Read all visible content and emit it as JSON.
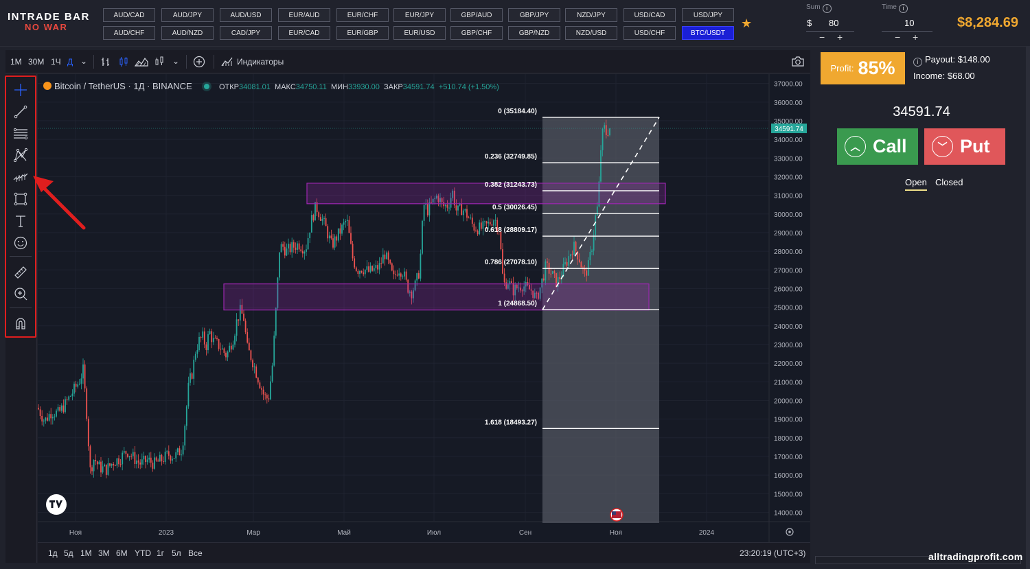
{
  "logo": {
    "line1": "INTRADE BAR",
    "line2": "NO WAR"
  },
  "pairs": {
    "row1": [
      "AUD/CAD",
      "AUD/JPY",
      "AUD/USD",
      "EUR/AUD",
      "EUR/CHF",
      "EUR/JPY",
      "GBP/AUD",
      "GBP/JPY",
      "NZD/JPY",
      "USD/CAD",
      "USD/JPY"
    ],
    "row2": [
      "AUD/CHF",
      "AUD/NZD",
      "CAD/JPY",
      "EUR/CAD",
      "EUR/GBP",
      "EUR/USD",
      "GBP/CHF",
      "GBP/NZD",
      "NZD/USD",
      "USD/CHF",
      "BTC/USDT"
    ],
    "active": "BTC/USDT"
  },
  "sum": {
    "label": "Sum",
    "currency": "$",
    "value": "80",
    "minus": "−",
    "plus": "+"
  },
  "time": {
    "label": "Time",
    "value": "10",
    "minus": "−",
    "plus": "+"
  },
  "balance": "$8,284.69",
  "toolbar": {
    "intervals": [
      "1М",
      "30М",
      "1Ч",
      "Д"
    ],
    "active_interval": "Д",
    "indicators_label": "Индикаторы",
    "icons": [
      "bar-chart-icon",
      "candle-chart-icon",
      "area-chart-icon",
      "chart-type-icon",
      "add-icon",
      "camera-icon"
    ]
  },
  "drawing_tools": [
    "crosshair-icon",
    "trend-line-icon",
    "fib-levels-icon",
    "pattern-icon",
    "forecast-icon",
    "rectangle-icon",
    "text-icon",
    "emoji-icon",
    "ruler-icon",
    "zoom-icon",
    "magnet-icon"
  ],
  "legend": {
    "symbol": "Bitcoin / TetherUS · 1Д · BINANCE",
    "open_label": "ОТКР",
    "open": "34081.01",
    "high_label": "МАКС",
    "high": "34750.11",
    "low_label": "МИН",
    "low": "33930.00",
    "close_label": "ЗАКР",
    "close": "34591.74",
    "change": "+510.74 (+1.50%)"
  },
  "chart_data": {
    "type": "candlestick",
    "y_ticks": [
      "37000.00",
      "36000.00",
      "35000.00",
      "34000.00",
      "33000.00",
      "32000.00",
      "31000.00",
      "30000.00",
      "29000.00",
      "28000.00",
      "27000.00",
      "26000.00",
      "25000.00",
      "24000.00",
      "23000.00",
      "22000.00",
      "21000.00",
      "20000.00",
      "19000.00",
      "18000.00",
      "17000.00",
      "16000.00",
      "15000.00",
      "14000.00"
    ],
    "ylim": [
      13500,
      37500
    ],
    "x_ticks": [
      "Ноя",
      "2023",
      "Мар",
      "Май",
      "Июл",
      "Сен",
      "Ноя",
      "2024"
    ],
    "last_price_label": "34591.74",
    "fib_levels": [
      {
        "label": "0 (35184.40)",
        "price": 35184.4
      },
      {
        "label": "0.236 (32749.85)",
        "price": 32749.85
      },
      {
        "label": "0.382 (31243.73)",
        "price": 31243.73
      },
      {
        "label": "0.5 (30026.45)",
        "price": 30026.45
      },
      {
        "label": "0.618 (28809.17)",
        "price": 28809.17
      },
      {
        "label": "0.786 (27078.10)",
        "price": 27078.1
      },
      {
        "label": "1 (24868.50)",
        "price": 24868.5
      },
      {
        "label": "1.618 (18493.27)",
        "price": 18493.27
      }
    ],
    "zones": [
      {
        "price_top": 31650,
        "price_bottom": 30550
      },
      {
        "price_top": 26250,
        "price_bottom": 24850
      }
    ],
    "price_path": [
      [
        0,
        19600
      ],
      [
        10,
        18900
      ],
      [
        20,
        19400
      ],
      [
        30,
        19300
      ],
      [
        40,
        19800
      ],
      [
        50,
        20400
      ],
      [
        60,
        21000
      ],
      [
        66,
        21600
      ],
      [
        72,
        19000
      ],
      [
        76,
        16200
      ],
      [
        82,
        16900
      ],
      [
        90,
        16400
      ],
      [
        100,
        16300
      ],
      [
        110,
        16700
      ],
      [
        120,
        16900
      ],
      [
        130,
        17300
      ],
      [
        140,
        16900
      ],
      [
        150,
        16600
      ],
      [
        160,
        16800
      ],
      [
        170,
        16600
      ],
      [
        180,
        16800
      ],
      [
        190,
        17100
      ],
      [
        200,
        17000
      ],
      [
        210,
        17400
      ],
      [
        215,
        19000
      ],
      [
        220,
        20900
      ],
      [
        225,
        21500
      ],
      [
        230,
        22700
      ],
      [
        235,
        23200
      ],
      [
        240,
        23400
      ],
      [
        245,
        22900
      ],
      [
        250,
        23700
      ],
      [
        255,
        23200
      ],
      [
        265,
        22900
      ],
      [
        275,
        22400
      ],
      [
        285,
        23400
      ],
      [
        290,
        24300
      ],
      [
        295,
        24800
      ],
      [
        300,
        24400
      ],
      [
        305,
        22800
      ],
      [
        312,
        22200
      ],
      [
        320,
        21300
      ],
      [
        330,
        20200
      ],
      [
        336,
        20100
      ],
      [
        342,
        22000
      ],
      [
        348,
        25500
      ],
      [
        352,
        28100
      ],
      [
        356,
        28300
      ],
      [
        362,
        28000
      ],
      [
        370,
        28200
      ],
      [
        380,
        28400
      ],
      [
        390,
        28100
      ],
      [
        398,
        29600
      ],
      [
        405,
        30400
      ],
      [
        412,
        29900
      ],
      [
        420,
        29200
      ],
      [
        428,
        28300
      ],
      [
        436,
        28800
      ],
      [
        444,
        29300
      ],
      [
        450,
        29700
      ],
      [
        458,
        27700
      ],
      [
        465,
        27000
      ],
      [
        472,
        27100
      ],
      [
        482,
        26900
      ],
      [
        490,
        27000
      ],
      [
        498,
        27200
      ],
      [
        505,
        27900
      ],
      [
        512,
        27200
      ],
      [
        518,
        26500
      ],
      [
        525,
        27100
      ],
      [
        532,
        26900
      ],
      [
        538,
        26100
      ],
      [
        544,
        25800
      ],
      [
        550,
        26200
      ],
      [
        556,
        27000
      ],
      [
        562,
        30500
      ],
      [
        568,
        30200
      ],
      [
        575,
        30600
      ],
      [
        582,
        31000
      ],
      [
        590,
        30400
      ],
      [
        598,
        30500
      ],
      [
        604,
        31200
      ],
      [
        610,
        30100
      ],
      [
        618,
        30300
      ],
      [
        626,
        29900
      ],
      [
        635,
        29300
      ],
      [
        645,
        29200
      ],
      [
        655,
        29400
      ],
      [
        665,
        29800
      ],
      [
        672,
        29200
      ],
      [
        678,
        26200
      ],
      [
        685,
        26400
      ],
      [
        692,
        25900
      ],
      [
        700,
        26100
      ],
      [
        706,
        26200
      ],
      [
        712,
        26000
      ],
      [
        720,
        25900
      ],
      [
        726,
        25400
      ],
      [
        732,
        26100
      ],
      [
        740,
        27200
      ],
      [
        748,
        26800
      ],
      [
        756,
        26300
      ],
      [
        764,
        26900
      ],
      [
        772,
        27600
      ],
      [
        780,
        28300
      ],
      [
        788,
        27700
      ],
      [
        796,
        26700
      ],
      [
        802,
        27200
      ],
      [
        808,
        28500
      ],
      [
        812,
        29800
      ],
      [
        816,
        30500
      ],
      [
        820,
        33500
      ],
      [
        824,
        34700
      ],
      [
        828,
        34300
      ],
      [
        832,
        34600
      ]
    ]
  },
  "range_bar": {
    "ranges": [
      "1д",
      "5д",
      "1М",
      "3М",
      "6М",
      "YTD",
      "1г",
      "5л",
      "Все"
    ],
    "clock": "23:20:19 (UTC+3)"
  },
  "right_panel": {
    "profit_label": "Profit:",
    "profit_value": "85%",
    "payout": "Payout: $148.00",
    "income": "Income: $68.00",
    "current_price": "34591.74",
    "call_label": "Call",
    "put_label": "Put",
    "tabs": [
      "Open",
      "Closed"
    ]
  },
  "watermark": "alltradingprofit.com",
  "colors": {
    "accent": "#f0a830",
    "call": "#3a9a4f",
    "put": "#e0575a",
    "active_pair": "#1a1fd6",
    "up": "#26a69a",
    "down": "#ef5350",
    "zone": "#9c27b0"
  }
}
